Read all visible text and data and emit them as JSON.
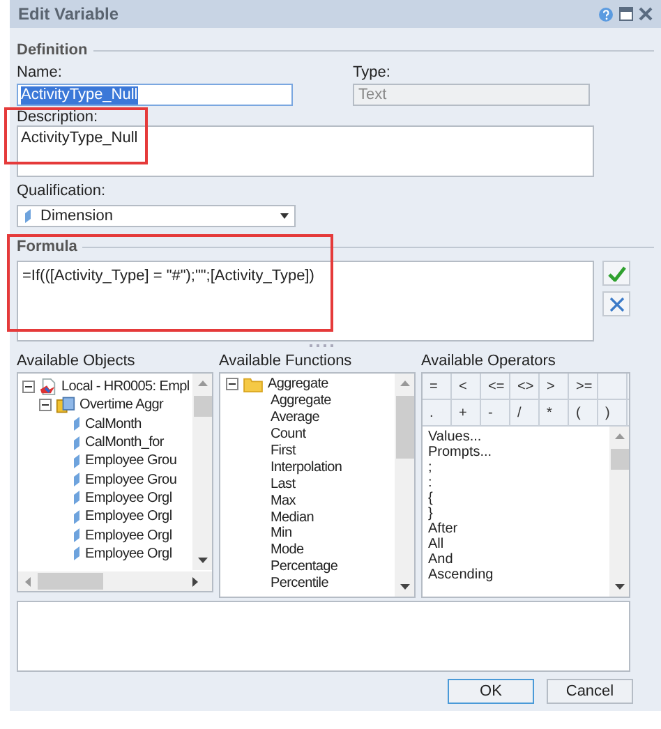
{
  "window": {
    "title": "Edit Variable"
  },
  "definition": {
    "header": "Definition",
    "name_label": "Name:",
    "name_value": "ActivityType_Null",
    "name_text_selected": true,
    "type_label": "Type:",
    "type_value": "Text",
    "type_disabled": true,
    "description_label": "Description:",
    "description_value": "ActivityType_Null",
    "qualification_label": "Qualification:",
    "qualification_value": "Dimension"
  },
  "formula": {
    "header": "Formula",
    "value": "=If(([Activity_Type] = \"#\");\"\";[Activity_Type])"
  },
  "objects": {
    "header": "Available Objects",
    "tree": [
      {
        "label": "Local - HR0005: Empl",
        "kind": "document",
        "expanded": true,
        "children": [
          {
            "label": "Overtime Aggr",
            "kind": "cube",
            "expanded": true,
            "children": [
              {
                "label": "CalMonth",
                "kind": "dimension"
              },
              {
                "label": "CalMonth_for",
                "kind": "dimension"
              },
              {
                "label": "Employee Grou",
                "kind": "dimension"
              },
              {
                "label": "Employee Grou",
                "kind": "dimension"
              },
              {
                "label": "Employee Orgl",
                "kind": "dimension"
              },
              {
                "label": "Employee Orgl",
                "kind": "dimension"
              },
              {
                "label": "Employee Orgl",
                "kind": "dimension"
              },
              {
                "label": "Employee Orgl",
                "kind": "dimension"
              }
            ]
          }
        ]
      }
    ]
  },
  "functions": {
    "header": "Available Functions",
    "tree": [
      {
        "label": "Aggregate",
        "kind": "folder",
        "expanded": true,
        "children": [
          {
            "label": "Aggregate"
          },
          {
            "label": "Average"
          },
          {
            "label": "Count"
          },
          {
            "label": "First"
          },
          {
            "label": "Interpolation"
          },
          {
            "label": "Last"
          },
          {
            "label": "Max"
          },
          {
            "label": "Median"
          },
          {
            "label": "Min"
          },
          {
            "label": "Mode"
          },
          {
            "label": "Percentage"
          },
          {
            "label": "Percentile"
          }
        ]
      }
    ]
  },
  "operators": {
    "header": "Available Operators",
    "buttons": [
      [
        "=",
        "<",
        "<=",
        "<>",
        ">",
        ">="
      ],
      [
        ".",
        "+",
        "-",
        "/",
        "*",
        "(",
        ")"
      ]
    ],
    "list": [
      "Values...",
      "Prompts...",
      ";",
      ":",
      "{",
      "}",
      "After",
      "All",
      "And",
      "Ascending"
    ]
  },
  "buttons": [
    {
      "label": "OK",
      "default": true
    },
    {
      "label": "Cancel",
      "default": false
    }
  ]
}
